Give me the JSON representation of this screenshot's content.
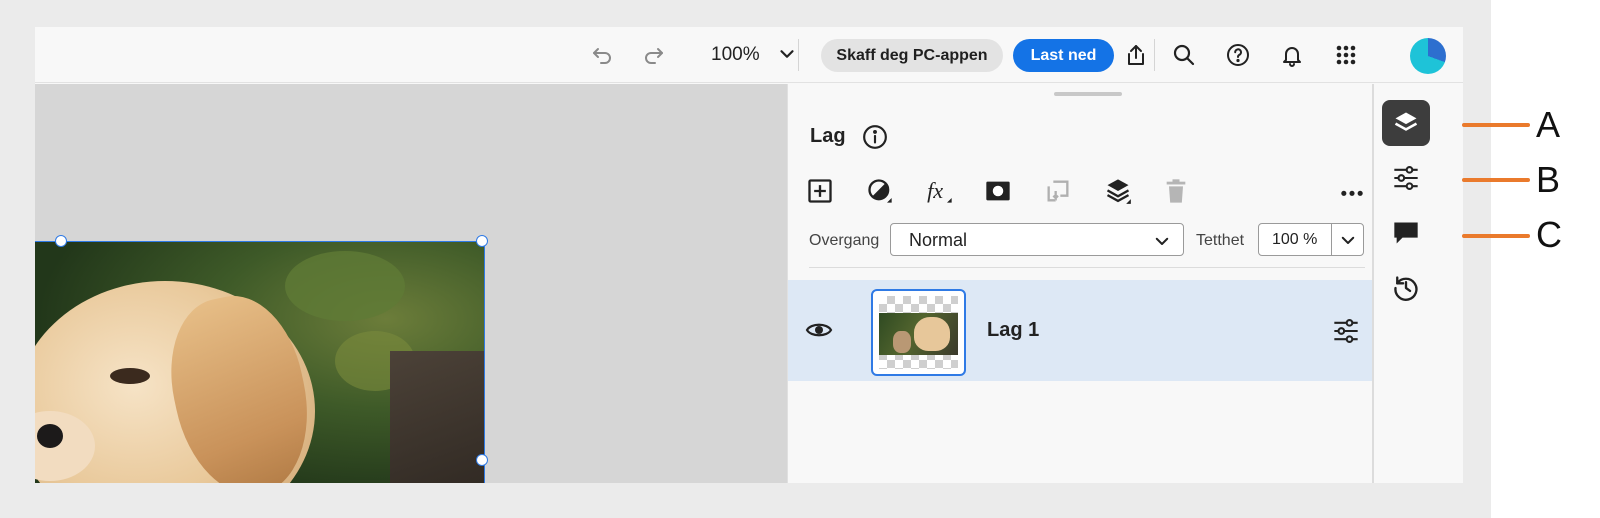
{
  "topbar": {
    "undo_icon": "undo-icon",
    "redo_icon": "redo-icon",
    "zoom_value": "100%",
    "get_app_label": "Skaff deg PC-appen",
    "download_label": "Last ned",
    "icons": [
      "share-icon",
      "search-icon",
      "help-icon",
      "notifications-icon",
      "apps-grid-icon"
    ]
  },
  "panel": {
    "title": "Lag",
    "blend_label": "Overgang",
    "blend_value": "Normal",
    "opacity_label": "Tetthet",
    "opacity_value": "100 %",
    "tools": [
      "add-layer-icon",
      "adjustment-layer-icon",
      "effects-icon",
      "mask-icon",
      "clipping-icon",
      "layer-stack-icon",
      "delete-icon",
      "more-icon"
    ]
  },
  "layers": [
    {
      "name": "Lag 1",
      "visible": true,
      "selected": true
    }
  ],
  "rail": {
    "items": [
      "layers-icon",
      "properties-icon",
      "comments-icon",
      "history-icon"
    ]
  },
  "callouts": [
    "A",
    "B",
    "C"
  ],
  "colors": {
    "accent": "#1473e6",
    "selection": "#2f7ae5",
    "callout": "#ea7a2c",
    "layer_row": "#dde8f5"
  }
}
